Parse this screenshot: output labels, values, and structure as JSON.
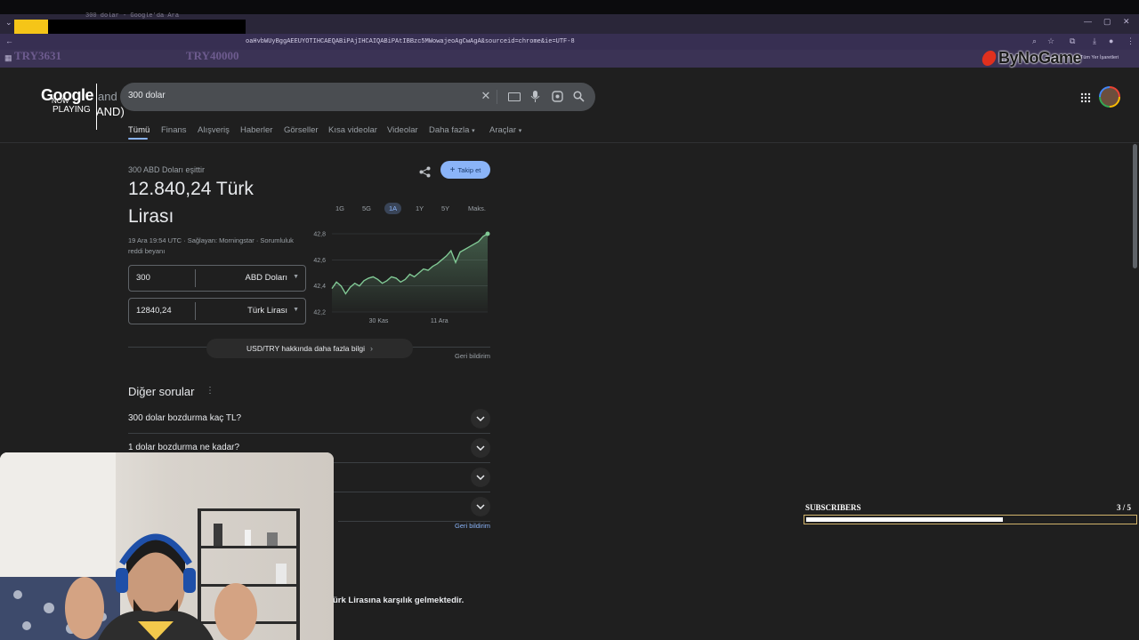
{
  "browser": {
    "tab_strip_title": "300 dolar - Google'da Ara",
    "address_url": "oaHvbWUyBggAEEUYOTIHCAEQABiPAjIHCAIQABiPAtIBBzc5MWowajeoAgCwAgA&sourceid=chrome&ie=UTF-8",
    "bookmarks_right": "Tüm Yer İşaretleri",
    "window_controls": [
      "—",
      "▢",
      "✕"
    ]
  },
  "overlay": {
    "try_left": "TRY3631",
    "try_right": "TRY40000",
    "logo_text": "ByNoGame",
    "now_playing_line1": "NOW",
    "now_playing_line2": "PLAYING",
    "now_playing_frag1": "and",
    "now_playing_frag2": "AND)",
    "subscribers_label": "SUBSCRIBERS",
    "subscribers_count": "3 / 5",
    "subscribers_progress": 0.6
  },
  "google": {
    "logo": "Google",
    "query": "300 dolar",
    "tabs": [
      "Tümü",
      "Finans",
      "Alışveriş",
      "Haberler",
      "Görseller",
      "Kısa videolar",
      "Videolar",
      "Daha fazla",
      "Araçlar"
    ]
  },
  "converter": {
    "subtitle": "300 ABD Doları eşittir",
    "result_line1": "12.840,24 Türk",
    "result_line2": "Lirası",
    "meta_line1": "19 Ara 19:54 UTC · Sağlayan: Morningstar · Sorumluluk",
    "meta_line2": "reddi beyanı",
    "follow_label": "Takip et",
    "from_value": "300",
    "from_currency": "ABD Doları",
    "to_value": "12840,24",
    "to_currency": "Türk Lirası",
    "more_info": "USD/TRY hakkında daha fazla bilgi",
    "feedback": "Geri bildirim"
  },
  "chart_data": {
    "type": "area",
    "ranges": [
      "1G",
      "5G",
      "1A",
      "1Y",
      "5Y",
      "Maks."
    ],
    "selected_range": "1A",
    "y_ticks": [
      "42,8",
      "42,6",
      "42,4",
      "42,2"
    ],
    "ylim": [
      42.2,
      42.8
    ],
    "x_tick_labels": [
      "30 Kas",
      "11 Ara"
    ],
    "line_color": "#81c995",
    "values": [
      42.38,
      42.43,
      42.4,
      42.34,
      42.39,
      42.42,
      42.4,
      42.44,
      42.46,
      42.47,
      42.45,
      42.42,
      42.44,
      42.47,
      42.46,
      42.43,
      42.45,
      42.49,
      42.47,
      42.5,
      42.53,
      42.52,
      42.55,
      42.57,
      42.6,
      42.63,
      42.67,
      42.58,
      42.66,
      42.68,
      42.7,
      42.72,
      42.74,
      42.78,
      42.8
    ]
  },
  "faq": {
    "title": "Diğer sorular",
    "questions": [
      "300 dolar bozdurma kaç TL?",
      "1 dolar bozdurma ne kadar?"
    ],
    "feedback": "Geri bildirim",
    "snippet_tail": "ürk Lirasına karşılık gelmektedir."
  }
}
